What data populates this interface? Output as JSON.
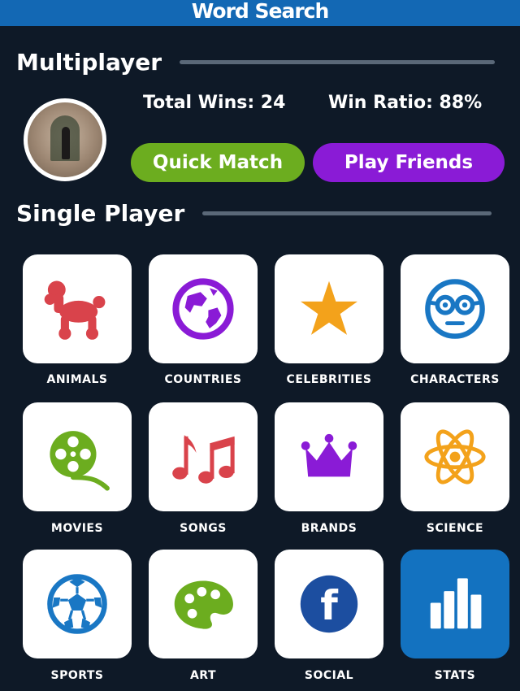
{
  "app_title": "Word Search",
  "multiplayer": {
    "heading": "Multiplayer",
    "total_wins": "Total Wins: 24",
    "win_ratio": "Win Ratio: 88%",
    "quick_match_label": "Quick Match",
    "play_friends_label": "Play Friends"
  },
  "single_player": {
    "heading": "Single Player",
    "categories": [
      {
        "label": "ANIMALS",
        "icon": "poodle-icon"
      },
      {
        "label": "COUNTRIES",
        "icon": "globe-icon"
      },
      {
        "label": "CELEBRITIES",
        "icon": "star-icon"
      },
      {
        "label": "CHARACTERS",
        "icon": "nerd-face-icon"
      },
      {
        "label": "MOVIES",
        "icon": "film-reel-icon"
      },
      {
        "label": "SONGS",
        "icon": "music-notes-icon"
      },
      {
        "label": "BRANDS",
        "icon": "crown-icon"
      },
      {
        "label": "SCIENCE",
        "icon": "atom-icon"
      },
      {
        "label": "SPORTS",
        "icon": "soccer-ball-icon"
      },
      {
        "label": "ART",
        "icon": "paint-palette-icon"
      },
      {
        "label": "SOCIAL",
        "icon": "facebook-icon"
      },
      {
        "label": "STATS",
        "icon": "bar-chart-icon"
      }
    ]
  },
  "colors": {
    "background": "#0e1927",
    "header": "#1368b4",
    "quick_match": "#6cad1f",
    "play_friends": "#8a1bd6",
    "animals": "#d9434b",
    "countries": "#8a1bd6",
    "celebrities": "#f3a21b",
    "characters": "#1977c4",
    "stats_tile": "#1372c0"
  }
}
